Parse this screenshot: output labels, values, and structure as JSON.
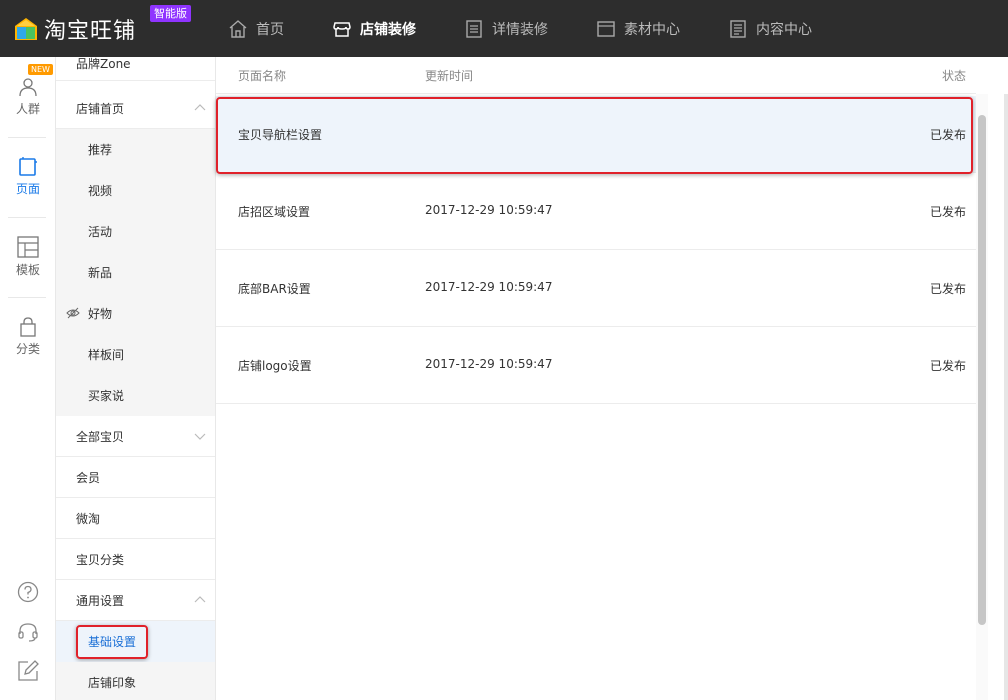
{
  "brand": {
    "name": "淘宝旺铺",
    "badge": "智能版"
  },
  "nav": [
    {
      "label": "首页",
      "icon": "home-icon",
      "active": false
    },
    {
      "label": "店铺装修",
      "icon": "store-icon",
      "active": true
    },
    {
      "label": "详情装修",
      "icon": "document-icon",
      "active": false
    },
    {
      "label": "素材中心",
      "icon": "folder-icon",
      "active": false
    },
    {
      "label": "内容中心",
      "icon": "list-icon",
      "active": false
    }
  ],
  "rail": {
    "new_badge": "NEW",
    "items": [
      {
        "label": "人群",
        "icon": "user-icon"
      },
      {
        "label": "页面",
        "icon": "page-icon"
      },
      {
        "label": "模板",
        "icon": "template-icon"
      },
      {
        "label": "分类",
        "icon": "bag-icon"
      }
    ]
  },
  "menu": {
    "items": [
      {
        "label": "品牌Zone"
      },
      {
        "label": "店铺首页"
      },
      {
        "label": "推荐"
      },
      {
        "label": "视频"
      },
      {
        "label": "活动"
      },
      {
        "label": "新品"
      },
      {
        "label": "好物"
      },
      {
        "label": "样板间"
      },
      {
        "label": "买家说"
      },
      {
        "label": "全部宝贝"
      },
      {
        "label": "会员"
      },
      {
        "label": "微淘"
      },
      {
        "label": "宝贝分类"
      },
      {
        "label": "通用设置"
      },
      {
        "label": "基础设置"
      },
      {
        "label": "店铺印象"
      }
    ]
  },
  "table": {
    "headers": {
      "name": "页面名称",
      "time": "更新时间",
      "status": "状态"
    },
    "rows": [
      {
        "name": "宝贝导航栏设置",
        "time": "",
        "status": "已发布"
      },
      {
        "name": "店招区域设置",
        "time": "2017-12-29 10:59:47",
        "status": "已发布"
      },
      {
        "name": "底部BAR设置",
        "time": "2017-12-29 10:59:47",
        "status": "已发布"
      },
      {
        "name": "店铺logo设置",
        "time": "2017-12-29 10:59:47",
        "status": "已发布"
      }
    ]
  },
  "colors": {
    "accent": "#1a7ae8",
    "highlight": "#e0212a",
    "topbar": "#2d2d2d"
  }
}
